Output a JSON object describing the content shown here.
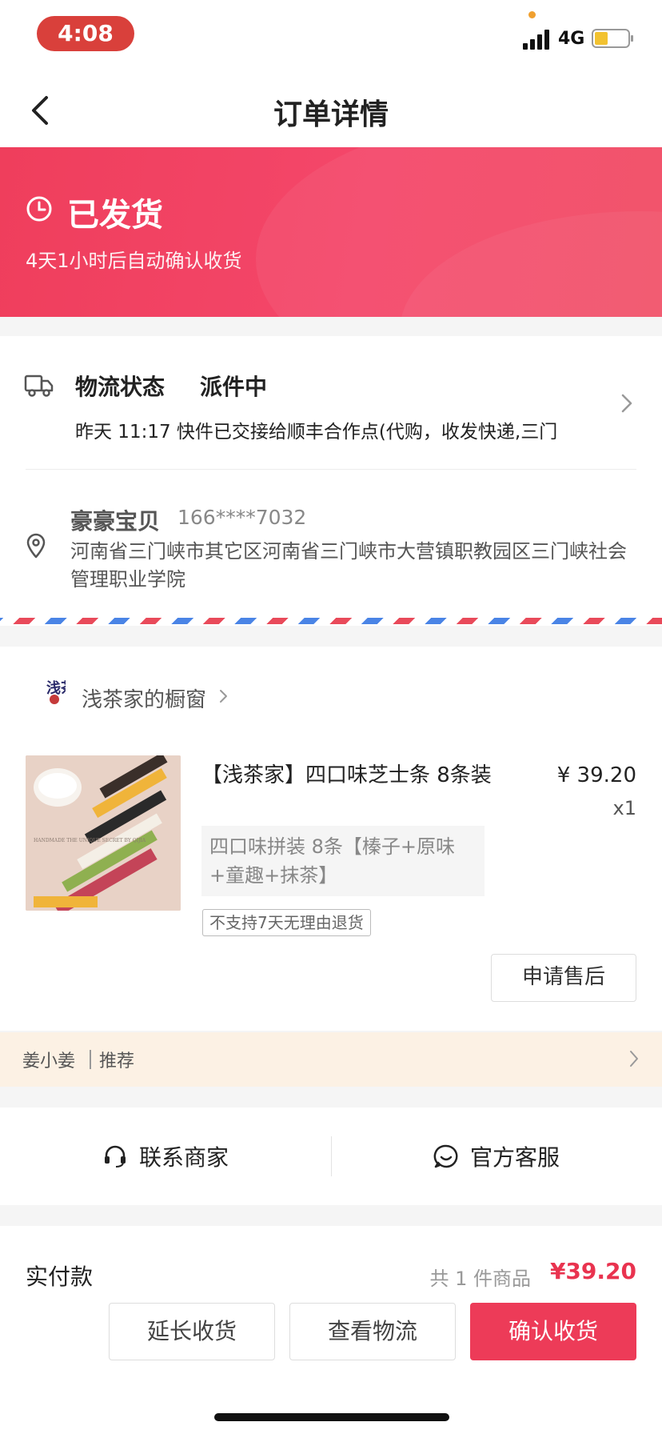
{
  "status_bar": {
    "time": "4:08",
    "network": "4G",
    "battery_level": 0.4
  },
  "nav": {
    "title": "订单详情",
    "back_icon": "chevron-left-icon"
  },
  "banner": {
    "status": "已发货",
    "subtitle": "4天1小时后自动确认收货",
    "icon": "clock-icon",
    "colors": {
      "from": "#ef3e5c",
      "to": "#f24a62"
    }
  },
  "logistics": {
    "label": "物流状态",
    "status": "派件中",
    "detail": "昨天 11:17 快件已交接给顺丰合作点(代购，收发快递,三门",
    "icon": "truck-icon"
  },
  "receiver": {
    "name": "豪豪宝贝",
    "phone": "166****7032",
    "address": "河南省三门峡市其它区河南省三门峡市大营镇职教园区三门峡社会管理职业学院",
    "icon": "location-pin-icon"
  },
  "shop": {
    "name": "浅茶家的橱窗",
    "logo_text": "浅茶",
    "product": {
      "title": "【浅茶家】四口味芝士条 8条装",
      "price": "¥ 39.20",
      "qty": "x1",
      "spec": "四口味拼装 8条【榛子+原味+童趣+抹茶】",
      "tag": "不支持7天无理由退货",
      "image_text": "HANDMADE THE UNIQUE SECRET BY QIJIA"
    },
    "after_sale_label": "申请售后"
  },
  "recommend": {
    "name": "姜小姜",
    "label": "推荐"
  },
  "contact": {
    "merchant": "联系商家",
    "official": "官方客服"
  },
  "payment": {
    "label": "实付款",
    "count": "共 1 件商品",
    "total": "¥39.20"
  },
  "actions": {
    "extend": "延长收货",
    "track": "查看物流",
    "confirm": "确认收货"
  },
  "colors": {
    "accent": "#ed3b58",
    "price_red": "#e9334f",
    "recommend_bg": "#fcf1e4"
  }
}
